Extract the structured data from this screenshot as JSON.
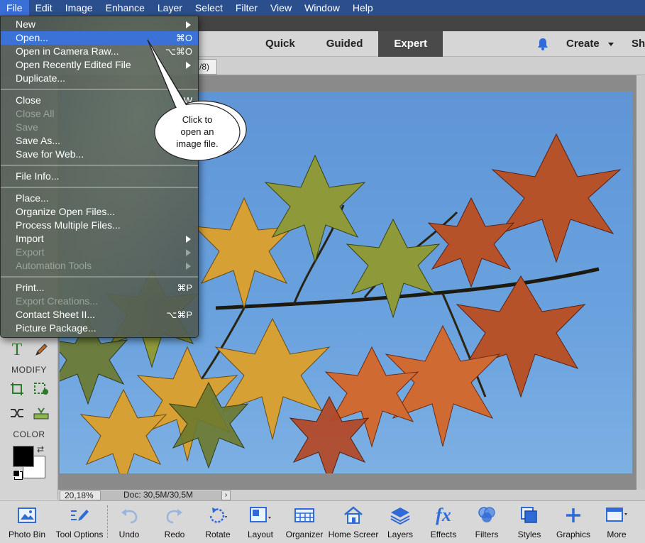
{
  "menubar": {
    "items": [
      "File",
      "Edit",
      "Image",
      "Enhance",
      "Layer",
      "Select",
      "Filter",
      "View",
      "Window",
      "Help"
    ]
  },
  "modes": {
    "items": [
      "Quick",
      "Guided",
      "Expert"
    ],
    "selected": "Expert"
  },
  "header": {
    "create_label": "Create",
    "share_label": "Sh"
  },
  "tab": {
    "label": "/8)"
  },
  "file_menu": {
    "items": [
      {
        "label": "New",
        "shortcut": "",
        "submenu": true,
        "disabled": false
      },
      {
        "label": "Open...",
        "shortcut": "⌘O",
        "submenu": false,
        "disabled": false,
        "highlighted": true
      },
      {
        "label": "Open in Camera Raw...",
        "shortcut": "⌥⌘O",
        "submenu": false,
        "disabled": false
      },
      {
        "label": "Open Recently Edited File",
        "shortcut": "",
        "submenu": true,
        "disabled": false
      },
      {
        "label": "Duplicate...",
        "shortcut": "",
        "submenu": false,
        "disabled": false
      },
      {
        "label": "Close",
        "shortcut": "⌘W",
        "submenu": false,
        "disabled": false
      },
      {
        "label": "Close All",
        "shortcut": "",
        "submenu": false,
        "disabled": true
      },
      {
        "label": "Save",
        "shortcut": "",
        "submenu": false,
        "disabled": true
      },
      {
        "label": "Save As...",
        "shortcut": "",
        "submenu": false,
        "disabled": false
      },
      {
        "label": "Save for Web...",
        "shortcut": "⌥⇧",
        "submenu": false,
        "disabled": false
      },
      {
        "label": "File Info...",
        "shortcut": "",
        "submenu": false,
        "disabled": false
      },
      {
        "label": "Place...",
        "shortcut": "",
        "submenu": false,
        "disabled": false
      },
      {
        "label": "Organize Open Files...",
        "shortcut": "",
        "submenu": false,
        "disabled": false
      },
      {
        "label": "Process Multiple Files...",
        "shortcut": "",
        "submenu": false,
        "disabled": false
      },
      {
        "label": "Import",
        "shortcut": "",
        "submenu": true,
        "disabled": false
      },
      {
        "label": "Export",
        "shortcut": "",
        "submenu": true,
        "disabled": true
      },
      {
        "label": "Automation Tools",
        "shortcut": "",
        "submenu": true,
        "disabled": true
      },
      {
        "label": "Print...",
        "shortcut": "⌘P",
        "submenu": false,
        "disabled": false
      },
      {
        "label": "Export Creations...",
        "shortcut": "",
        "submenu": false,
        "disabled": true
      },
      {
        "label": "Contact Sheet II...",
        "shortcut": "⌥⌘P",
        "submenu": false,
        "disabled": false
      },
      {
        "label": "Picture Package...",
        "shortcut": "",
        "submenu": false,
        "disabled": false
      }
    ]
  },
  "callout": {
    "line1": "Click to",
    "line2": "open an",
    "line3": "image file."
  },
  "left_panel": {
    "modify_label": "MODIFY",
    "color_label": "COLOR"
  },
  "status": {
    "zoom": "20,18%",
    "doc": "Doc: 30,5M/30,5M"
  },
  "taskbar": {
    "items": [
      "Photo Bin",
      "Tool Options",
      "Undo",
      "Redo",
      "Rotate",
      "Layout",
      "Organizer",
      "Home Screer",
      "Layers",
      "Effects",
      "Filters",
      "Styles",
      "Graphics",
      "More"
    ]
  },
  "colors": {
    "menubar": "#2b4f8c",
    "highlight": "#3a72d8",
    "sky": "#6aa2df",
    "accent_blue": "#2f6ad6"
  }
}
